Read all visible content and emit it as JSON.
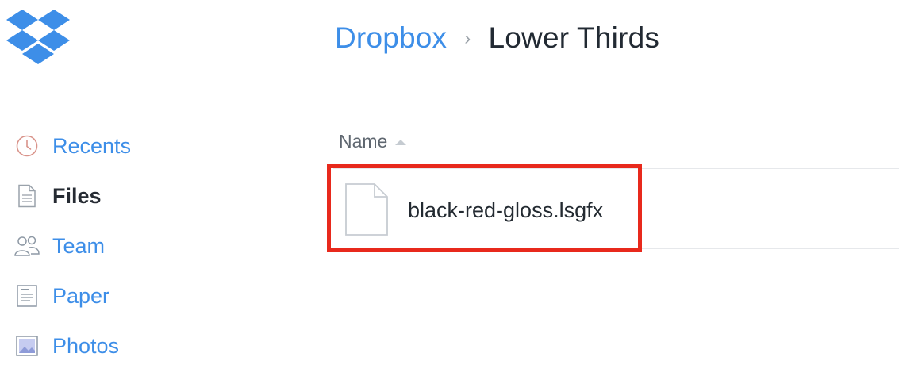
{
  "logo": {
    "icon": "dropbox-logo-icon",
    "color": "#3d8ee8"
  },
  "breadcrumb": {
    "root": "Dropbox",
    "separator": "›",
    "current": "Lower Thirds"
  },
  "sidebar": {
    "items": [
      {
        "label": "Recents",
        "icon": "clock-icon",
        "active": false
      },
      {
        "label": "Files",
        "icon": "file-icon",
        "active": true
      },
      {
        "label": "Team",
        "icon": "team-icon",
        "active": false
      },
      {
        "label": "Paper",
        "icon": "paper-icon",
        "active": false
      },
      {
        "label": "Photos",
        "icon": "photos-icon",
        "active": false
      }
    ]
  },
  "file_list": {
    "header": {
      "name_label": "Name",
      "sort": "ascending",
      "sort_icon": "sort-up-icon"
    },
    "files": [
      {
        "name": "black-red-gloss.lsgfx",
        "icon": "file-icon",
        "highlighted": true
      }
    ]
  },
  "colors": {
    "accent": "#3d8ee8",
    "highlight": "#e8291c",
    "text_dark": "#232a31"
  }
}
